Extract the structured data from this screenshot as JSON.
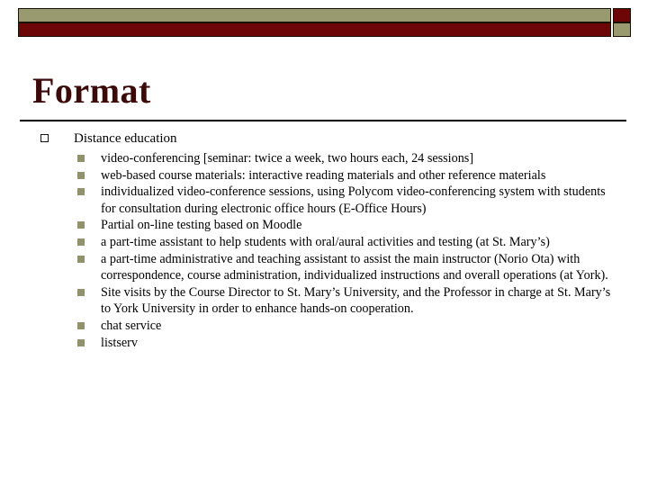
{
  "theme": {
    "olive": "#9a9a70",
    "maroon": "#6d0606",
    "title_color": "#3d0a0a",
    "body_color": "#000000",
    "background": "#ffffff",
    "bullet_level2_color": "#91916b"
  },
  "header": {
    "bars": [
      {
        "name": "top-bar",
        "long_fill": "olive",
        "cap_fill": "maroon"
      },
      {
        "name": "bottom-bar",
        "long_fill": "maroon",
        "cap_fill": "olive"
      }
    ]
  },
  "slide": {
    "title": "Format",
    "outline": {
      "level1": {
        "bullet_glyph": "square-outline",
        "text": "Distance education"
      },
      "level2_bullet_glyph": "square-filled",
      "items": [
        "video-conferencing [seminar: twice a week, two hours each,  24 sessions]",
        "web-based course materials: interactive reading materials and other reference materials",
        "individualized video-conference sessions, using Polycom video-conferencing system with students for consultation during electronic office hours (E-Office Hours)",
        "Partial on-line testing based on Moodle",
        "a part-time assistant to help students with oral/aural activities and testing (at St. Mary’s)",
        "a part-time administrative and teaching assistant to assist the main instructor (Norio Ota) with correspondence, course administration, individualized instructions and overall operations (at York).",
        "Site visits by the Course Director to St. Mary’s University, and the Professor in charge at St. Mary’s to York University in order to enhance hands-on cooperation.",
        "chat service",
        "listserv"
      ]
    }
  }
}
